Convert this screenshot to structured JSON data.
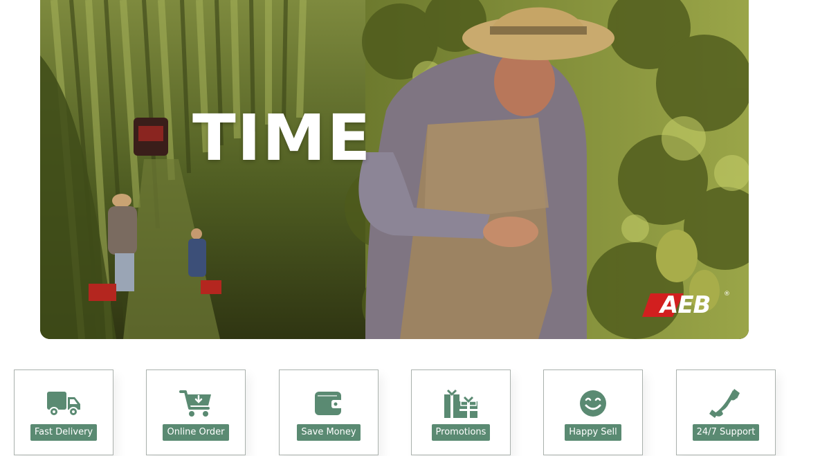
{
  "hero": {
    "overlay_word": "TIME",
    "brand": "AEB",
    "brand_mark": "®"
  },
  "colors": {
    "accent_green": "#5a8a72",
    "card_border": "#a9b0ac"
  },
  "features": [
    {
      "label": "Fast Delivery",
      "icon": "truck-icon"
    },
    {
      "label": "Online Order",
      "icon": "cart-icon"
    },
    {
      "label": "Save Money",
      "icon": "wallet-icon"
    },
    {
      "label": "Promotions",
      "icon": "gifts-icon"
    },
    {
      "label": "Happy Sell",
      "icon": "smile-icon"
    },
    {
      "label": "24/7 Support",
      "icon": "phone-icon"
    }
  ]
}
